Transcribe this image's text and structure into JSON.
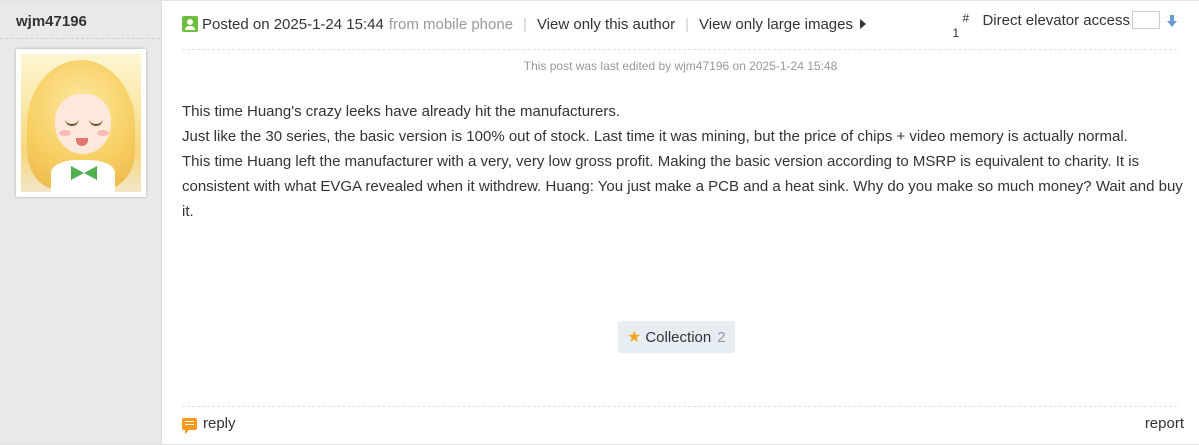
{
  "author": {
    "username": "wjm47196",
    "avatar_desc": "anime-avatar"
  },
  "meta": {
    "posted_on": "Posted on 2025-1-24 15:44",
    "from": "from mobile phone",
    "view_author": "View only this author",
    "view_images": "View only large images"
  },
  "elevator": {
    "hash": "#",
    "floor": "1",
    "label": "Direct elevator access",
    "input_value": ""
  },
  "edit_note": "This post was last edited by wjm47196 on 2025-1-24 15:48",
  "body": {
    "paragraphs": [
      "This time Huang's crazy leeks have already hit the manufacturers.",
      "Just like the 30 series, the basic version is 100% out of stock. Last time it was mining, but the price of chips + video memory is actually normal.",
      "This time Huang left the manufacturer with a very, very low gross profit. Making the basic version according to MSRP is equivalent to charity. It is consistent with what EVGA revealed when it withdrew. Huang: You just make a PCB and a heat sink. Why do you make so much money? Wait and buy it."
    ]
  },
  "collection": {
    "label": "Collection",
    "count": "2"
  },
  "footer": {
    "reply": "reply",
    "report": "report"
  },
  "colors": {
    "author_bg": "#e9e9e9",
    "accent_star": "#f4a621",
    "reply_icon": "#f49a1a",
    "user_icon": "#6cbf3a"
  }
}
